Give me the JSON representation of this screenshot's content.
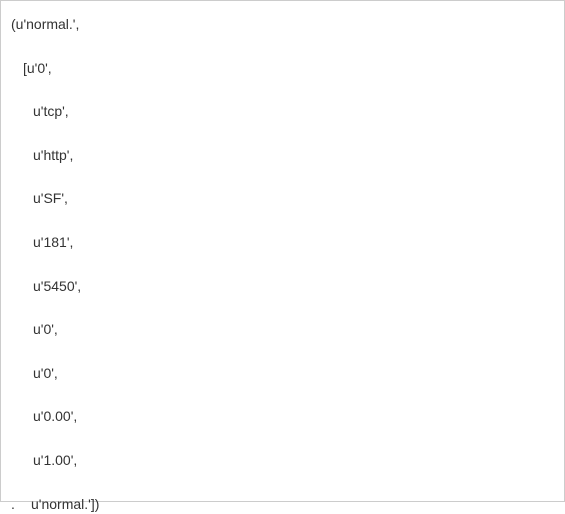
{
  "lines": {
    "l0": "(u'normal.',",
    "l1": "[u'0',",
    "l2": "u'tcp',",
    "l3": "u'http',",
    "l4": "u'SF',",
    "l5": "u'181',",
    "l6": "u'5450',",
    "l7": "u'0',",
    "l8": "u'0',",
    "l9": "u'0.00',",
    "l10": "u'1.00',",
    "l11_dot": ".",
    "l11": "u'normal.'])"
  }
}
